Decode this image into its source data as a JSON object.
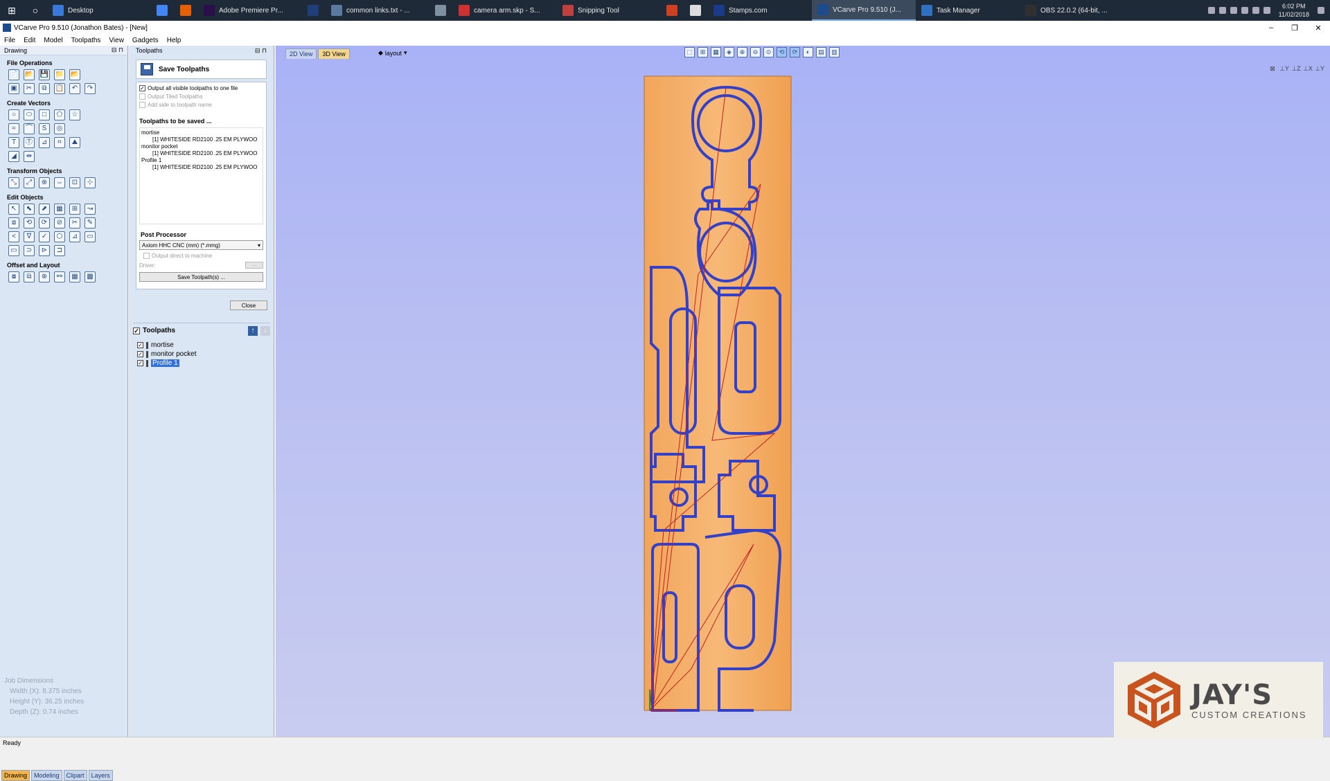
{
  "taskbar": {
    "items": [
      {
        "label": "Desktop",
        "color": "#3a78d8"
      },
      {
        "label": "",
        "color": "#4285f4"
      },
      {
        "label": "",
        "color": "#e66000"
      },
      {
        "label": "Adobe Premiere Pr...",
        "color": "#2a0f4a"
      },
      {
        "label": "",
        "color": "#1f3f7a"
      },
      {
        "label": "common links.txt - ...",
        "color": "#5a7aa0"
      },
      {
        "label": "",
        "color": "#8090a0"
      },
      {
        "label": "camera arm.skp - S...",
        "color": "#d03030"
      },
      {
        "label": "Snipping Tool",
        "color": "#c04040"
      },
      {
        "label": "",
        "color": "#d04020"
      },
      {
        "label": "",
        "color": "#dddddd"
      },
      {
        "label": "Stamps.com",
        "color": "#1a3a8a"
      },
      {
        "label": "VCarve Pro 9.510 (J...",
        "color": "#1c4c8c"
      },
      {
        "label": "Task Manager",
        "color": "#3070c0"
      },
      {
        "label": "OBS 22.0.2 (64-bit, ...",
        "color": "#303030"
      }
    ],
    "active_index": 12,
    "time": "6:02 PM",
    "date": "11/02/2018"
  },
  "window": {
    "title": "VCarve Pro 9.510 (Jonathon Bates) - [New]",
    "controls": [
      "–",
      "❐",
      "✕"
    ]
  },
  "menu": [
    "File",
    "Edit",
    "Model",
    "Toolpaths",
    "View",
    "Gadgets",
    "Help"
  ],
  "left_panel": {
    "header": "Drawing",
    "sections": [
      {
        "title": "File Operations",
        "rows": [
          [
            "📄",
            "📂",
            "💾",
            "📁",
            "📂"
          ],
          [
            "▣",
            "✂",
            "⧉",
            "📋",
            "↶",
            "↷"
          ]
        ]
      },
      {
        "title": "Create Vectors",
        "rows": [
          [
            "○",
            "⬭",
            "□",
            "⬠",
            "☆"
          ],
          [
            "≈",
            "⌒",
            "S",
            "◎"
          ],
          [
            "T",
            "Ⓣ",
            "⊿",
            "⌗",
            "⛰"
          ],
          [
            "◢",
            "⇹"
          ]
        ]
      },
      {
        "title": "Transform Objects",
        "rows": [
          [
            "⤡",
            "⤢",
            "⊕",
            "⇔",
            "⊡",
            "⊹"
          ]
        ]
      },
      {
        "title": "Edit Objects",
        "rows": [
          [
            "↖",
            "⬉",
            "⬈",
            "▦",
            "⊞",
            "↝"
          ],
          [
            "⧈",
            "⟲",
            "⟳",
            "⊘",
            "✂",
            "✎"
          ],
          [
            "<",
            "∇",
            "✓",
            "⬡",
            "⊿",
            "▭"
          ],
          [
            "▭",
            "⊃",
            "⊳",
            "⊐"
          ]
        ]
      },
      {
        "title": "Offset and Layout",
        "rows": [
          [
            "⧇",
            "⧉",
            "⊕",
            "⚯",
            "▦",
            "▩"
          ]
        ]
      }
    ],
    "job_dimensions": {
      "title": "Job Dimensions",
      "width": "Width  (X): 8.375 inches",
      "height": "Height (Y): 36.25 inches",
      "depth": "Depth  (Z): 0.74 inches"
    },
    "tabs": [
      "Drawing",
      "Modeling",
      "Clipart",
      "Layers"
    ]
  },
  "toolpaths_panel": {
    "header": "Toolpaths",
    "save_title": "Save Toolpaths",
    "options": [
      {
        "label": "Output all visible toolpaths to one file",
        "checked": true,
        "disabled": false
      },
      {
        "label": "Output Tiled Toolpaths",
        "checked": false,
        "disabled": true
      },
      {
        "label": "Add side to toolpath name",
        "checked": false,
        "disabled": true
      }
    ],
    "to_be_saved_title": "Toolpaths to be saved ...",
    "to_be_saved": [
      {
        "text": "mortise",
        "indent": false
      },
      {
        "text": "[1] WHITESIDE RD2100 .25 EM PLYWOO",
        "indent": true
      },
      {
        "text": "monitor pocket",
        "indent": false
      },
      {
        "text": "[1] WHITESIDE RD2100 .25 EM PLYWOO",
        "indent": true
      },
      {
        "text": "Profile 1",
        "indent": false
      },
      {
        "text": "[1] WHITESIDE RD2100 .25 EM PLYWOO",
        "indent": true
      }
    ],
    "post_processor_title": "Post Processor",
    "post_processor_value": "Axiom HHC CNC (mm) (*.mmg)",
    "output_direct": "Output direct to machine",
    "driver_label": "Driver:",
    "driver_btn": "...",
    "save_button": "Save Toolpath(s) ...",
    "close_button": "Close",
    "list_title": "Toolpaths",
    "list": [
      {
        "name": "mortise",
        "selected": false
      },
      {
        "name": "monitor pocket",
        "selected": false
      },
      {
        "name": "Profile 1",
        "selected": true
      }
    ]
  },
  "viewport": {
    "tabs": [
      "2D View",
      "3D View"
    ],
    "selected_tab": 1,
    "layout_label": "layout",
    "toolbar_icons": [
      "⬚",
      "⊞",
      "▦",
      "◈",
      "⊕",
      "⊖",
      "⊙",
      "⟲",
      "⟳",
      "◐",
      "▤",
      "▥"
    ],
    "corner_icons": [
      "⊠",
      "⊥Y",
      "⊥Z",
      "⊥X",
      "⊥Y"
    ]
  },
  "status": "Ready",
  "logo": {
    "title": "JAY'S",
    "subtitle": "CUSTOM CREATIONS",
    "color": "#c8531f"
  }
}
